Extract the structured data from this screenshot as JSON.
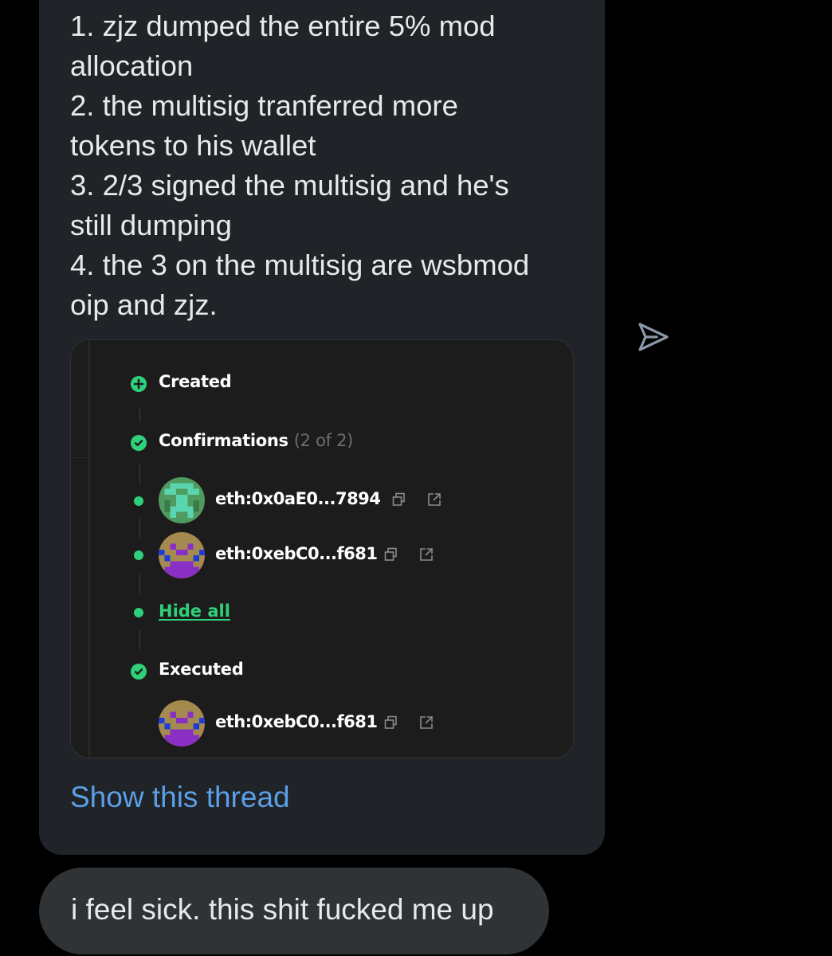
{
  "message": {
    "lines": [
      "1. zjz dumped the entire 5% mod",
      "allocation",
      "2. the multisig tranferred more",
      "tokens to his wallet",
      "3. 2/3 signed the multisig and he's",
      "still dumping",
      "4. the 3 on the multisig are wsbmod",
      "oip and zjz."
    ]
  },
  "embed": {
    "created_label": "Created",
    "confirmations_label": "Confirmations",
    "confirmations_count": "(2 of 2)",
    "signers": [
      {
        "address": "eth:0x0aE0...7894"
      },
      {
        "address": "eth:0xebC0...f681"
      }
    ],
    "hide_all_label": "Hide all",
    "executed_label": "Executed",
    "executor": {
      "address": "eth:0xebC0...f681"
    }
  },
  "show_thread_label": "Show this thread",
  "reply": {
    "text": "i feel sick. this shit fucked me up"
  },
  "icons": {
    "share": "send-icon",
    "copy": "copy-icon",
    "external": "external-link-icon",
    "created": "plus-circle-icon",
    "confirmed": "check-circle-icon"
  },
  "colors": {
    "bubble": "#202327",
    "reply_bubble": "#2f3336",
    "link": "#5b9fe6",
    "accent_green": "#2fd07a"
  }
}
